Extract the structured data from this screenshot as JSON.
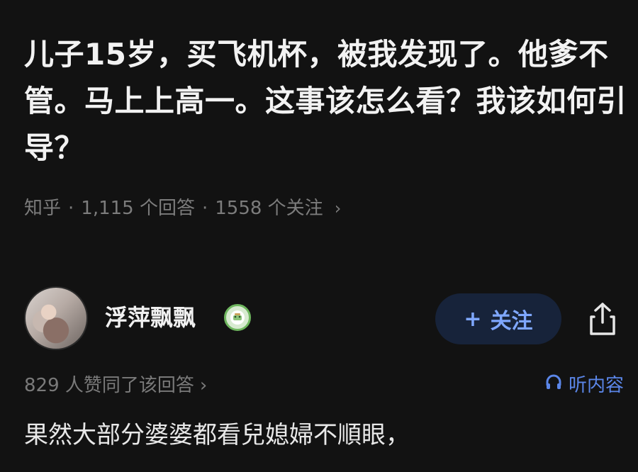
{
  "question": {
    "title": "儿子15岁，买飞机杯，被我发现了。他爹不管。马上上高一。这事该怎么看？我该如何引导？"
  },
  "meta": {
    "source": "知乎",
    "separator": "·",
    "answers": "1,115 个回答",
    "follows": "1558 个关注",
    "chevron": "›"
  },
  "author": {
    "name": "浮萍飘飘",
    "follow_label": "关注",
    "follow_plus": "+"
  },
  "stats": {
    "likes": "829 人赞同了该回答",
    "chevron": "›",
    "listen_label": "听内容"
  },
  "answer": {
    "text": "果然大部分婆婆都看兒媳婦不順眼，"
  },
  "colors": {
    "background": "#121212",
    "accent": "#5b86e8",
    "follow_bg": "#17233a",
    "muted": "#7a7a7a"
  },
  "icons": [
    "share-icon",
    "headphones-icon",
    "badge-icon",
    "chevron-right-icon",
    "plus-icon"
  ]
}
